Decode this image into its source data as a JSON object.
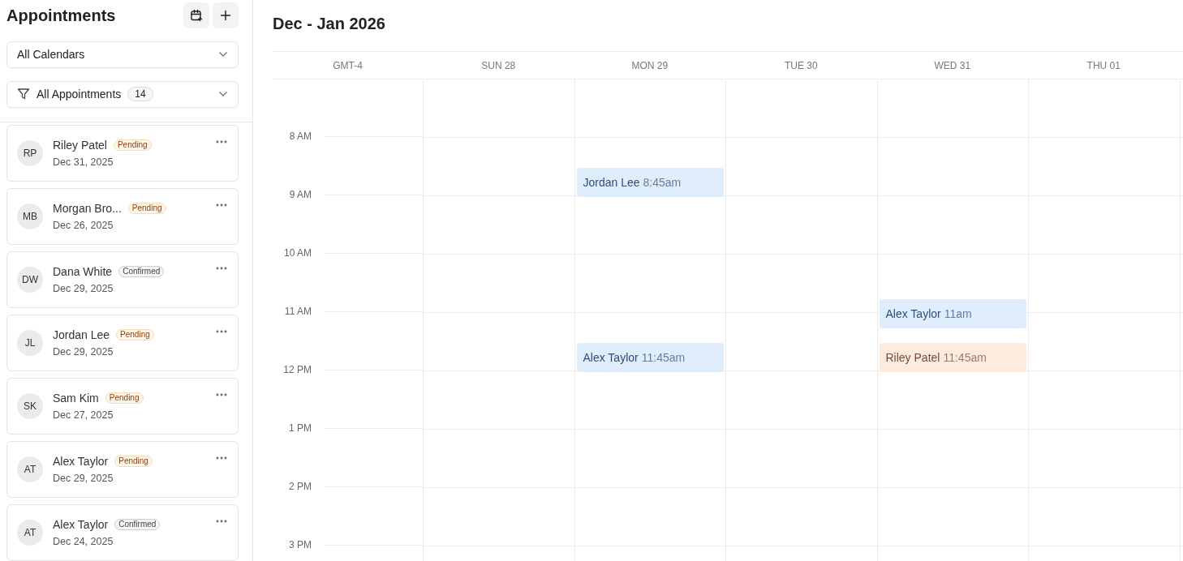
{
  "sidebar": {
    "title": "Appointments",
    "calendar_select": {
      "value": "All Calendars"
    },
    "filter_select": {
      "value": "All Appointments",
      "count": "14"
    },
    "appointments": [
      {
        "initials": "RP",
        "name": "Riley Patel",
        "status": {
          "label": "Pending",
          "kind": "pending"
        },
        "date": "Dec 31, 2025"
      },
      {
        "initials": "MB",
        "name": "Morgan Bro...",
        "status": {
          "label": "Pending",
          "kind": "pending"
        },
        "date": "Dec 26, 2025"
      },
      {
        "initials": "DW",
        "name": "Dana White",
        "status": {
          "label": "Confirmed",
          "kind": "confirmed"
        },
        "date": "Dec 29, 2025"
      },
      {
        "initials": "JL",
        "name": "Jordan Lee",
        "status": {
          "label": "Pending",
          "kind": "pending"
        },
        "date": "Dec 29, 2025"
      },
      {
        "initials": "SK",
        "name": "Sam Kim",
        "status": {
          "label": "Pending",
          "kind": "pending"
        },
        "date": "Dec 27, 2025"
      },
      {
        "initials": "AT",
        "name": "Alex Taylor",
        "status": {
          "label": "Pending",
          "kind": "pending"
        },
        "date": "Dec 29, 2025"
      },
      {
        "initials": "AT",
        "name": "Alex Taylor",
        "status": {
          "label": "Confirmed",
          "kind": "confirmed"
        },
        "date": "Dec 24, 2025"
      }
    ]
  },
  "calendar": {
    "title": "Dec - Jan 2026",
    "timezone": "GMT-4",
    "hours": [
      "8 AM",
      "9 AM",
      "10 AM",
      "11 AM",
      "12 PM",
      "1 PM",
      "2 PM",
      "3 PM"
    ],
    "days": [
      {
        "label": "SUN 28"
      },
      {
        "label": "MON 29",
        "events": [
          {
            "name": "Jordan Lee",
            "time": "8:45am",
            "color": "#e0edfd"
          },
          {
            "name": "Alex Taylor",
            "time": "11:45am",
            "color": "#e0edfd"
          }
        ]
      },
      {
        "label": "TUE 30"
      },
      {
        "label": "WED 31",
        "events": [
          {
            "name": "Alex Taylor",
            "time": "11am",
            "color": "#e0edfd"
          },
          {
            "name": "Riley Patel",
            "time": "11:45am",
            "color": "#fdebdf"
          }
        ]
      },
      {
        "label": "THU 01"
      }
    ]
  }
}
